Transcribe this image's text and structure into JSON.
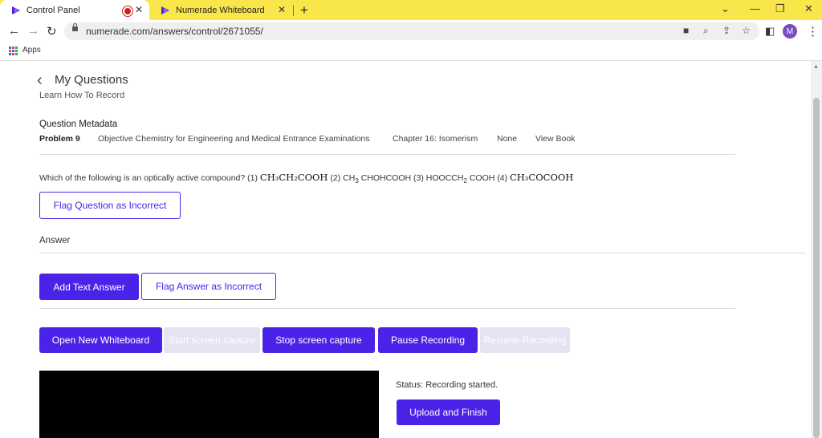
{
  "browser": {
    "tabs": [
      {
        "title": "Control Panel",
        "active": true,
        "recording": true
      },
      {
        "title": "Numerade Whiteboard",
        "active": false
      }
    ],
    "url": "numerade.com/answers/control/2671055/",
    "profile_initial": "M",
    "bookmarks_label": "Apps"
  },
  "page": {
    "title": "My Questions",
    "subtitle": "Learn How To Record",
    "metadata_heading": "Question Metadata",
    "metadata": {
      "problem": "Problem 9",
      "book": "Objective Chemistry for Engineering and Medical Entrance Examinations",
      "chapter": "Chapter 16: Isomerism",
      "section": "None",
      "view_book": "View Book"
    },
    "question": {
      "prefix": "Which of the following is an optically active compound? (1)",
      "f1": "CH₃CH₂COOH",
      "p2": "(2) CH",
      "s2": "3",
      "p2b": "CHOHCOOH (3) HOOCCH",
      "s3": "2",
      "p3b": "COOH (4)",
      "f4": "CH₃COCOOH"
    },
    "flag_question": "Flag Question as Incorrect",
    "answer_heading": "Answer",
    "add_text_answer": "Add Text Answer",
    "flag_answer": "Flag Answer as Incorrect",
    "recording_buttons": {
      "open_whiteboard": "Open New Whiteboard",
      "start_capture": "Start screen capture",
      "stop_capture": "Stop screen capture",
      "pause": "Pause Recording",
      "resume": "Resume Recording"
    },
    "status": "Status: Recording started.",
    "upload": "Upload and Finish"
  },
  "colors": {
    "accent": "#4b23e8",
    "tabbar": "#f9e64a",
    "disabled": "#e3e3f2"
  },
  "icons": [
    "numerade-logo-icon",
    "record-icon",
    "close-icon",
    "new-tab-icon",
    "back-icon",
    "forward-icon",
    "reload-icon",
    "lock-icon",
    "camera-icon",
    "zoom-icon",
    "share-icon",
    "star-icon",
    "sidepanel-icon",
    "menu-icon",
    "apps-icon",
    "chevron-left-icon"
  ]
}
